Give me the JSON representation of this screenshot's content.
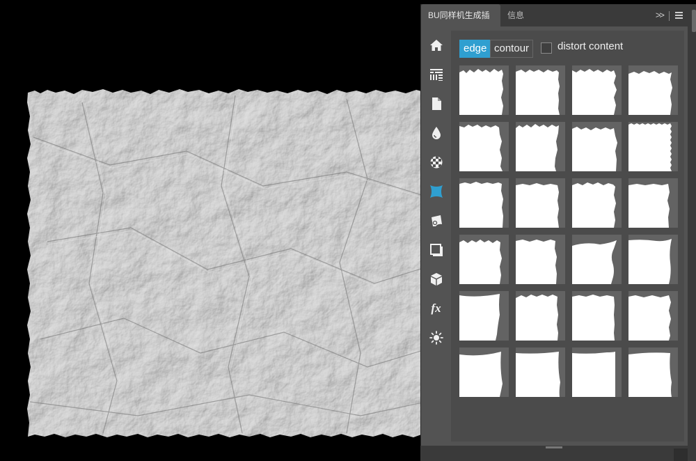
{
  "panel": {
    "tabs": [
      {
        "label": "BU同样机生成插件"
      },
      {
        "label": "信息"
      }
    ],
    "collapse_glyph": ">>"
  },
  "sidebar": {
    "items": [
      {
        "icon": "home-icon"
      },
      {
        "icon": "pattern-grid-icon"
      },
      {
        "icon": "document-icon"
      },
      {
        "icon": "drop-icon"
      },
      {
        "icon": "checker-ball-icon"
      },
      {
        "icon": "edge-shape-icon",
        "active": true,
        "accent": "#2f9fd0"
      },
      {
        "icon": "paper-curl-icon"
      },
      {
        "icon": "frame-icon"
      },
      {
        "icon": "cube-icon"
      },
      {
        "icon": "fx-icon",
        "text": "fx"
      },
      {
        "icon": "sun-icon"
      }
    ]
  },
  "toolbar": {
    "edge_label": "edge",
    "contour_label": "contour",
    "distort_label": "distort content",
    "distort_checked": false
  },
  "colors": {
    "accent": "#2f9fd0",
    "panel_bg": "#535353",
    "content_bg": "#4b4b4b",
    "tab_bar": "#3a3a3a",
    "thumb_bg": "#636363",
    "paper": "#a8a8a8"
  },
  "thumbnails": {
    "rows": 6,
    "cols": 4,
    "count": 24
  }
}
